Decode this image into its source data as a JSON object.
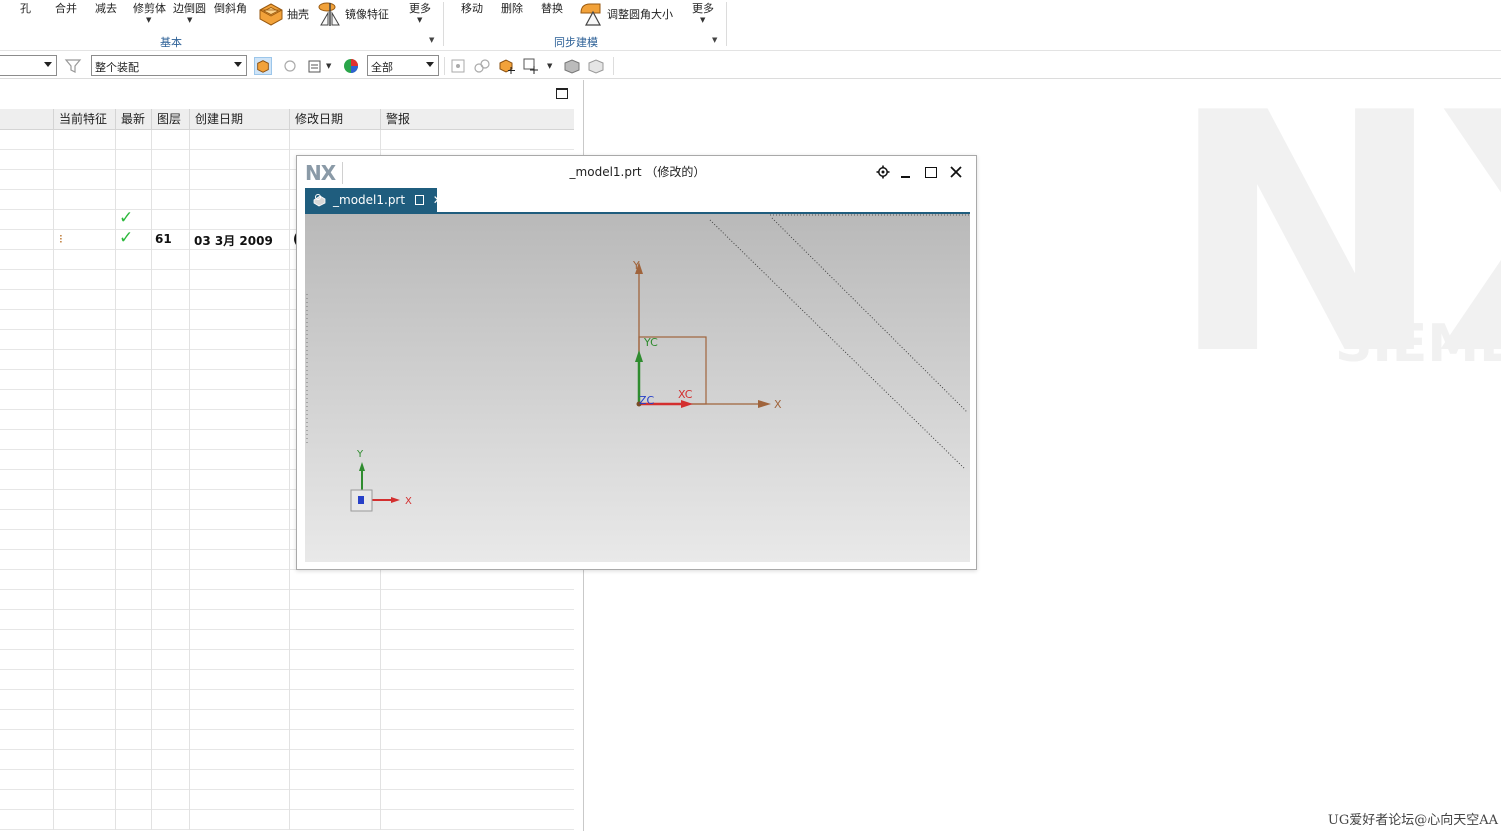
{
  "ribbon": {
    "buttons": {
      "hole": "孔",
      "unite": "合并",
      "subtract": "减去",
      "trim_body": "修剪体",
      "edge_blend": "边倒圆",
      "chamfer": "倒斜角",
      "shell": "抽壳",
      "mirror_feature": "镜像特征",
      "more1": "更多",
      "move": "移动",
      "delete": "删除",
      "replace": "替换",
      "resize_blend": "调整圆角大小",
      "more2": "更多"
    },
    "groups": {
      "basic": "基本",
      "sync_modeling": "同步建模"
    }
  },
  "toolbar": {
    "scope_combo": "整个装配",
    "layer_combo": "全部"
  },
  "navigator": {
    "columns": [
      "当前特征",
      "最新",
      "图层",
      "创建日期",
      "修改日期",
      "警报"
    ],
    "rows": [
      {
        "current": "",
        "latest": "✓",
        "layer": "",
        "created": "",
        "modified": ""
      },
      {
        "current": "⁝",
        "latest": "✓",
        "layer": "61",
        "created": "03 3月 2009",
        "modified": "("
      }
    ]
  },
  "window": {
    "logo": "NX",
    "title": "_model1.prt （修改的）",
    "tab_label": "_model1.prt",
    "axes": {
      "y": "Y",
      "x": "X",
      "yc": "YC",
      "xc": "XC",
      "zc": "ZC",
      "mini_y": "Y",
      "mini_x": "X"
    }
  },
  "watermark": {
    "nx": "NX",
    "siemens": "SIEMENS",
    "forum": "UG爱好者论坛@心向天空AA"
  },
  "colors": {
    "tab_bg": "#1f5d7e",
    "group_label": "#2b5f96",
    "check_green": "#2db83d",
    "axis_brown": "#a0643c",
    "axis_green": "#2f8c2f",
    "axis_red": "#d32f2f",
    "axis_blue": "#2740c8"
  }
}
